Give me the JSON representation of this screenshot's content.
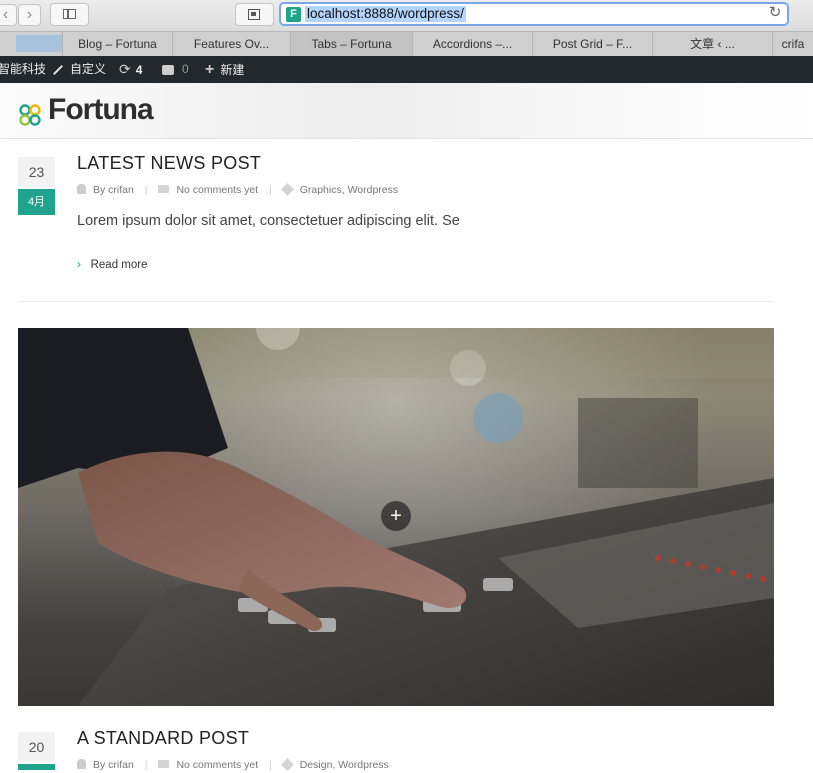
{
  "browser": {
    "url": "localhost:8888/wordpress/",
    "favicon_letter": "F",
    "back_icon": "‹",
    "forward_icon": "›",
    "reload_icon": "↻",
    "tabs": [
      {
        "label": ""
      },
      {
        "label": "Blog – Fortuna"
      },
      {
        "label": "Features Ov..."
      },
      {
        "label": "Tabs – Fortuna"
      },
      {
        "label": "Accordions –..."
      },
      {
        "label": "Post Grid – F..."
      },
      {
        "label": "文章 ‹ ..."
      },
      {
        "label": "crifa"
      }
    ]
  },
  "adminbar": {
    "site_name": "智能科技",
    "customize_label": "自定义",
    "updates_count": "4",
    "comments_count": "0",
    "new_label": "新建"
  },
  "header": {
    "logo_text": "Fortuna",
    "brand_color": "#1fa38c"
  },
  "posts": [
    {
      "day": "23",
      "month": "4月",
      "title": "LATEST NEWS POST",
      "author": "By crifan",
      "comments": "No comments yet",
      "categories": "Graphics, Wordpress",
      "excerpt": "Lorem ipsum dolor sit amet, consectetuer adipiscing elit. Se",
      "read_more": "Read more"
    },
    {
      "day": "20",
      "month": "",
      "title": "A STANDARD POST",
      "author": "By crifan",
      "comments": "No comments yet",
      "categories": "Design, Wordpress"
    }
  ],
  "media": {
    "plus_icon": "+"
  }
}
